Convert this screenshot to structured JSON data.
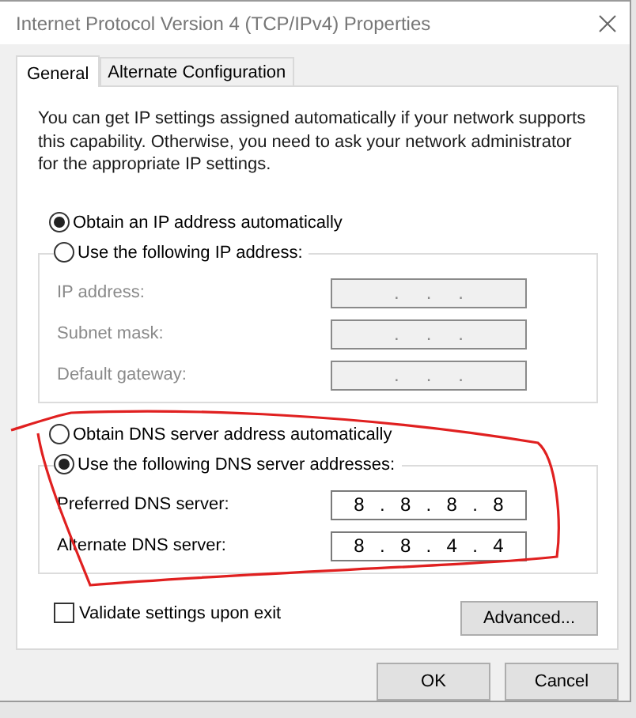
{
  "window": {
    "title": "Internet Protocol Version 4 (TCP/IPv4) Properties"
  },
  "tabs": [
    {
      "label": "General",
      "selected": true
    },
    {
      "label": "Alternate Configuration",
      "selected": false
    }
  ],
  "description": "You can get IP settings assigned automatically if your network supports this capability. Otherwise, you need to ask your network administrator for the appropriate IP settings.",
  "ip_section": {
    "auto_option": {
      "label": "Obtain an IP address automatically",
      "selected": true
    },
    "manual_option": {
      "label": "Use the following IP address:",
      "selected": false
    },
    "fields": [
      {
        "label": "IP address:",
        "disabled": true,
        "parts": [
          ".",
          ".",
          "."
        ]
      },
      {
        "label": "Subnet mask:",
        "disabled": true,
        "parts": [
          ".",
          ".",
          "."
        ]
      },
      {
        "label": "Default gateway:",
        "disabled": true,
        "parts": [
          ".",
          ".",
          "."
        ]
      }
    ]
  },
  "dns_section": {
    "auto_option": {
      "label": "Obtain DNS server address automatically",
      "selected": false
    },
    "manual_option": {
      "label": "Use the following DNS server addresses:",
      "selected": true
    },
    "fields": [
      {
        "label": "Preferred DNS server:",
        "disabled": false,
        "parts": [
          "8",
          ".",
          "8",
          ".",
          "8",
          ".",
          "8"
        ]
      },
      {
        "label": "Alternate DNS server:",
        "disabled": false,
        "parts": [
          "8",
          ".",
          "8",
          ".",
          "4",
          ".",
          "4"
        ]
      }
    ]
  },
  "validate": {
    "label": "Validate settings upon exit",
    "checked": false
  },
  "advanced_button": "Advanced...",
  "buttons": [
    "OK",
    "Cancel"
  ]
}
